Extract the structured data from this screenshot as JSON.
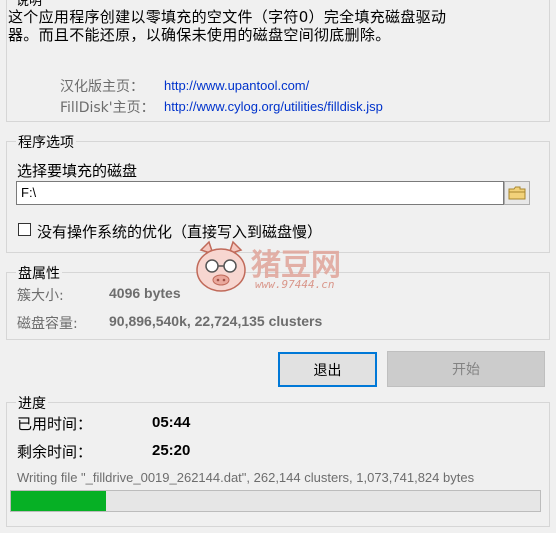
{
  "about": {
    "legend_partial": "说明",
    "description_line1": "这个应用程序创建以零填充的空文件（字符0）完全填充磁盘驱动",
    "description_line2": "器。而且不能还原，以确保未使用的磁盘空间彻底删除。",
    "cn_home_label": "汉化版主页：",
    "cn_home_url": "http://www.upantool.com/",
    "fd_home_label": "FillDisk'主页：",
    "fd_home_url": "http://www.cylog.org/utilities/filldisk.jsp"
  },
  "options": {
    "legend": "程序选项",
    "drive_label": "选择要填充的磁盘",
    "drive_value": "F:\\",
    "no_os_opt_label": "没有操作系统的优化（直接写入到磁盘慢）",
    "no_os_opt_checked": false
  },
  "disk": {
    "legend": "盘属性",
    "cluster_label": "簇大小:",
    "cluster_value": "4096 bytes",
    "capacity_label": "磁盘容量:",
    "capacity_value": "90,896,540k, 22,724,135 clusters"
  },
  "buttons": {
    "exit": "退出",
    "start": "开始"
  },
  "progress": {
    "legend": "进度",
    "elapsed_label": "已用时间：",
    "elapsed_value": "05:44",
    "remaining_label": "剩余时间：",
    "remaining_value": "25:20",
    "status": "Writing file \"_filldrive_0019_262144.dat\", 262,144 clusters, 1,073,741,824 bytes",
    "fraction": 0.18
  },
  "watermark": {
    "brand": "猪豆网",
    "url": "www.97444.cn"
  },
  "icons": {
    "folder": "folder-icon"
  }
}
